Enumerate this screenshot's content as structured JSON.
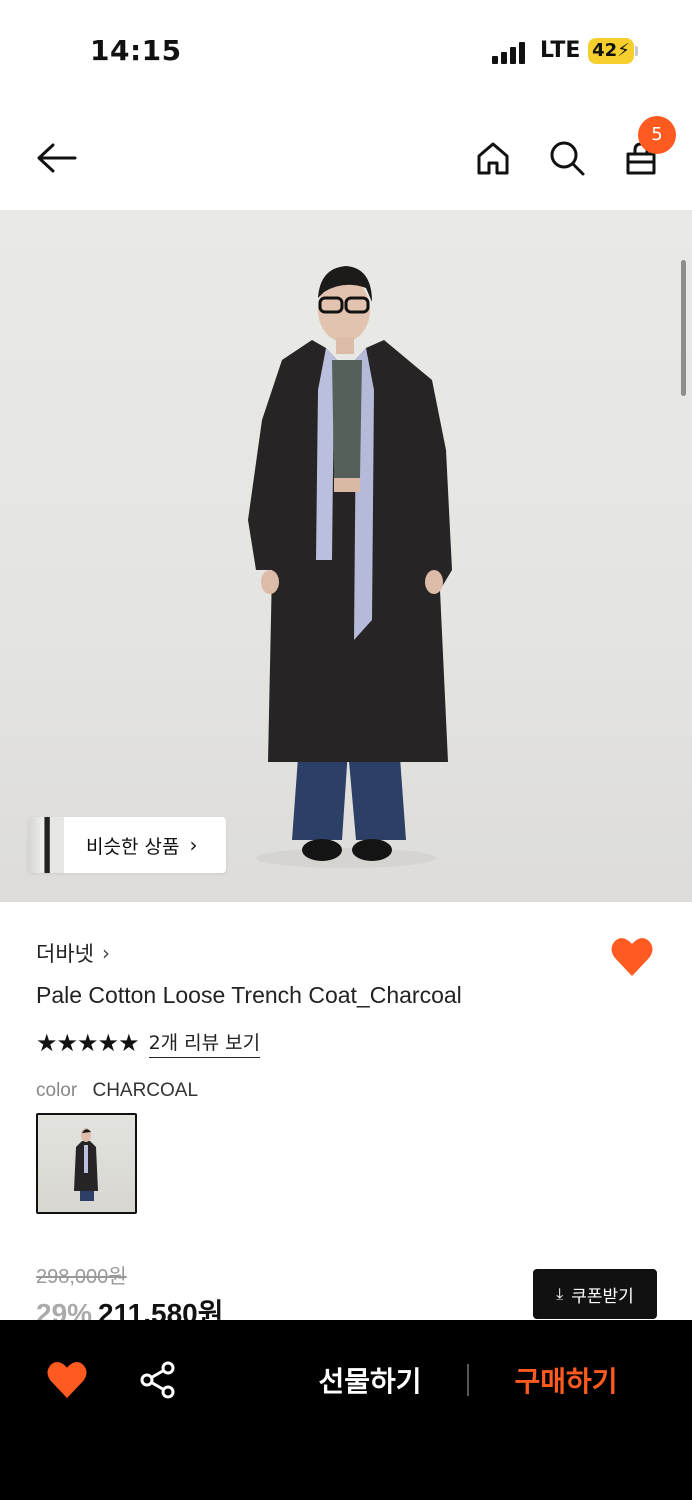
{
  "status_bar": {
    "time": "14:15",
    "network": "LTE",
    "battery": "42"
  },
  "header": {
    "cart_count": "5",
    "icons": [
      "back-arrow-icon",
      "home-icon",
      "search-icon",
      "shopping-bag-icon"
    ]
  },
  "image": {
    "similar_label": "비슷한 상품",
    "similar_chevron": "›"
  },
  "product": {
    "brand": "더바넷",
    "brand_chevron": "›",
    "name": "Pale Cotton Loose Trench Coat_Charcoal",
    "stars": "★★★★★",
    "review_link": "2개 리뷰 보기",
    "color_label": "color",
    "color_value": "CHARCOAL",
    "liked": true
  },
  "price": {
    "original": "298,000원",
    "discount": "29%",
    "sale": "211,580원",
    "coupon_label": "쿠폰받기",
    "coupon_icon": "⤓"
  },
  "bottom_bar": {
    "gift_label": "선물하기",
    "buy_label": "구매하기"
  },
  "colors": {
    "accent": "#ff5a1f",
    "battery": "#f6cf2e",
    "bottom_bar": "#000000"
  }
}
